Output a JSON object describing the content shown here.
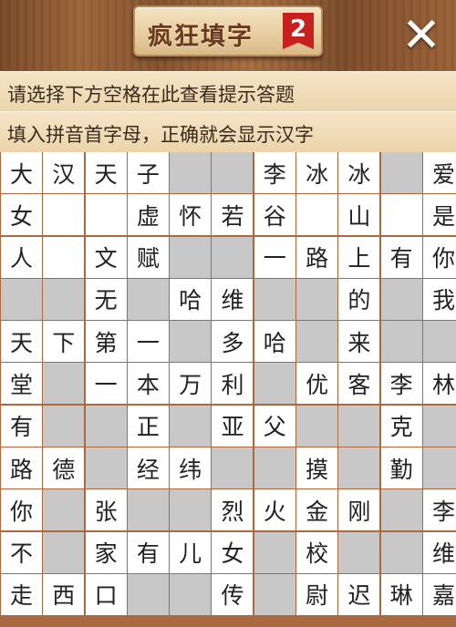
{
  "header": {
    "title": "疯狂填字",
    "level": "2",
    "close_icon": "close-x-icon"
  },
  "hints": {
    "line1": "请选择下方空格在此查看提示答题",
    "line2": "填入拼音首字母，正确就会显示汉字"
  },
  "grid": {
    "rows": [
      [
        "大",
        "汉",
        "天",
        "子",
        null,
        null,
        "李",
        "冰",
        "冰",
        null,
        "爱"
      ],
      [
        "女",
        "",
        "",
        "虚",
        "怀",
        "若",
        "谷",
        "",
        "山",
        "",
        "是"
      ],
      [
        "人",
        "",
        "文",
        "赋",
        null,
        null,
        "一",
        "路",
        "上",
        "有",
        "你"
      ],
      [
        null,
        null,
        "无",
        null,
        "哈",
        "维",
        null,
        null,
        "的",
        null,
        "我"
      ],
      [
        "天",
        "下",
        "第",
        "一",
        null,
        "多",
        "哈",
        null,
        "来",
        null,
        null
      ],
      [
        "堂",
        null,
        "一",
        "本",
        "万",
        "利",
        null,
        "优",
        "客",
        "李",
        "林"
      ],
      [
        "有",
        null,
        null,
        "正",
        null,
        "亚",
        "父",
        null,
        null,
        "克",
        null
      ],
      [
        "路",
        "德",
        null,
        "经",
        "纬",
        null,
        null,
        "摸",
        null,
        "勤",
        null
      ],
      [
        "你",
        null,
        "张",
        null,
        null,
        "烈",
        "火",
        "金",
        "刚",
        null,
        "李"
      ],
      [
        "不",
        null,
        "家",
        "有",
        "儿",
        "女",
        null,
        "校",
        null,
        null,
        "维"
      ],
      [
        "走",
        "西",
        "口",
        null,
        null,
        "传",
        null,
        "尉",
        "迟",
        "琳",
        "嘉"
      ]
    ]
  }
}
